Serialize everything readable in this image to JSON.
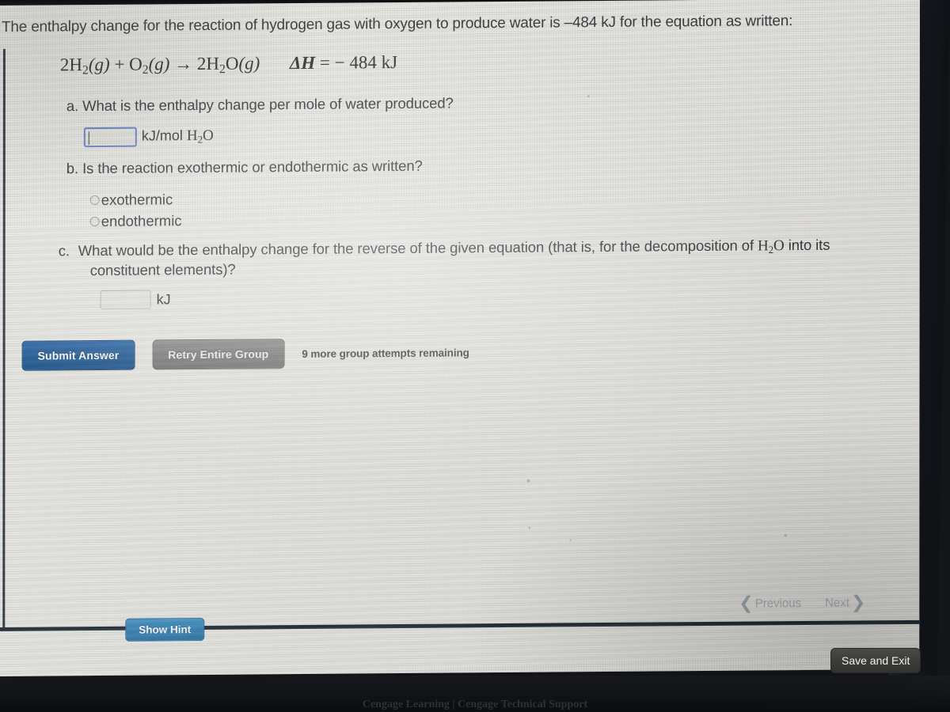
{
  "question": {
    "stem": "The enthalpy change for the reaction of hydrogen gas with oxygen to produce water is –484 kJ for the equation as written:",
    "equation": {
      "reactants_coeff_1": "2H",
      "sub_1": "2",
      "state_1": "(g)",
      "plus": "+",
      "reactants_coeff_2": "O",
      "sub_2": "2",
      "state_2": "(g)",
      "arrow": "→",
      "products_coeff": "2H",
      "sub_3": "2",
      "product_o": "O",
      "state_3": "(g)",
      "delta_h_symbol": "ΔH",
      "equals": "=",
      "delta_h_value": "− 484 kJ",
      "full_text": "2H2(g) + O2(g) → 2H2O(g)   ΔH = −484 kJ"
    },
    "parts": [
      {
        "label": "a.",
        "text": "What is the enthalpy change per mole of water produced?",
        "answer_value": "",
        "answer_focused": true,
        "unit_prefix": "kJ/mol ",
        "unit_formula_h": "H",
        "unit_formula_sub": "2",
        "unit_formula_o": "O"
      },
      {
        "label": "b.",
        "text": "Is the reaction exothermic or endothermic as written?",
        "options": [
          {
            "label": "exothermic",
            "selected": false
          },
          {
            "label": "endothermic",
            "selected": false
          }
        ]
      },
      {
        "label": "c.",
        "text_before": "What would be the enthalpy change for the reverse of the given equation (that is, for the decomposition of ",
        "formula_h": "H",
        "formula_sub": "2",
        "formula_o": "O",
        "text_after": " into its constituent elements)?",
        "answer_value": "",
        "answer_focused": false,
        "unit": "kJ"
      }
    ]
  },
  "actions": {
    "submit_label": "Submit Answer",
    "retry_label": "Retry Entire Group",
    "attempts_text": "9 more group attempts remaining",
    "hint_label": "Show Hint",
    "save_exit_label": "Save and Exit"
  },
  "pager": {
    "previous_label": "Previous",
    "next_label": "Next",
    "prev_chevron": "❮",
    "next_chevron": "❯"
  },
  "footer": {
    "text": "Cengage Learning | Cengage Technical Support"
  },
  "colors": {
    "submit_blue": "#15538f",
    "retry_gray": "#777776",
    "hint_blue": "#2f7fb4",
    "focus_border": "#5b7cc4",
    "screen_bg": "#e9e8e3",
    "text": "#2a2d31"
  }
}
